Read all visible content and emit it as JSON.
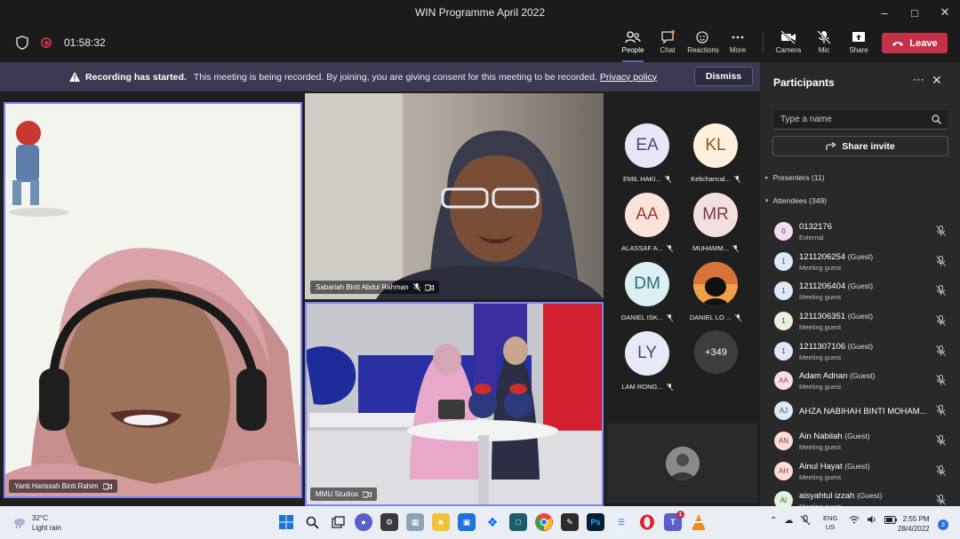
{
  "window": {
    "title": "WIN Programme April 2022"
  },
  "toolbar": {
    "timer": "01:58:32",
    "people": "People",
    "chat": "Chat",
    "reactions": "Reactions",
    "more": "More",
    "camera": "Camera",
    "mic": "Mic",
    "share": "Share",
    "leave": "Leave"
  },
  "banner": {
    "heading": "Recording has started.",
    "message": "This meeting is being recorded. By joining, you are giving consent for this meeting to be recorded.",
    "link": "Privacy policy",
    "dismiss": "Dismiss"
  },
  "stage": {
    "tiles": [
      {
        "name": "Yanti Harissah Binti Rahim"
      },
      {
        "name": "Sabariah Binti Abdul Rahman"
      },
      {
        "name": "MMU Studios"
      }
    ],
    "roster": [
      {
        "initials": "EA",
        "name": "EMIL HAKI...",
        "bg": "#e8e6f6"
      },
      {
        "initials": "KL",
        "name": "Kelichancal...",
        "bg": "#fdf0dc"
      },
      {
        "initials": "AA",
        "name": "ALASSAF A...",
        "bg": "#fbe3dc"
      },
      {
        "initials": "MR",
        "name": "MUHAMM...",
        "bg": "#f2dfe0"
      },
      {
        "initials": "DM",
        "name": "DANIEL ISK...",
        "bg": "#dcf0f3"
      },
      {
        "initials": "",
        "name": "DANIEL LO ...",
        "bg": "#c0703a"
      },
      {
        "initials": "LY",
        "name": "LAM RONG...",
        "bg": "#e8e9f6"
      }
    ],
    "more_count": "+349"
  },
  "panel": {
    "title": "Participants",
    "search_placeholder": "Type a name",
    "share_invite": "Share invite",
    "presenters": "Presenters (11)",
    "attendees": "Attendees (349)",
    "people": [
      {
        "initials": "0",
        "name": "0132176",
        "guest": "",
        "sub": "External",
        "bg": "#f2dcef"
      },
      {
        "initials": "1",
        "name": "1211206254",
        "guest": "(Guest)",
        "sub": "Meeting guest",
        "bg": "#dde9f8"
      },
      {
        "initials": "1",
        "name": "1211206404",
        "guest": "(Guest)",
        "sub": "Meeting guest",
        "bg": "#dde9f8"
      },
      {
        "initials": "1",
        "name": "1211306351",
        "guest": "(Guest)",
        "sub": "Meeting guest",
        "bg": "#e5f3dc"
      },
      {
        "initials": "1",
        "name": "1211307106",
        "guest": "(Guest)",
        "sub": "Meeting guest",
        "bg": "#dde9f8"
      },
      {
        "initials": "AA",
        "name": "Adam Adnan",
        "guest": "(Guest)",
        "sub": "Meeting guest",
        "bg": "#f6dfe6"
      },
      {
        "initials": "AJ",
        "name": "AHZA NABIHAH BINTI MOHAM...",
        "guest": "",
        "sub": "",
        "bg": "#dfe9f6"
      },
      {
        "initials": "AN",
        "name": "Ain Nabilah",
        "guest": "(Guest)",
        "sub": "Meeting guest",
        "bg": "#f8dcd6"
      },
      {
        "initials": "AH",
        "name": "Ainul Hayat",
        "guest": "(Guest)",
        "sub": "Meeting guest",
        "bg": "#f8dcd6"
      },
      {
        "initials": "AI",
        "name": "aisyahtul izzah",
        "guest": "(Guest)",
        "sub": "Meeting guest",
        "bg": "#e2f2dc"
      }
    ]
  },
  "taskbar": {
    "temp": "32°C",
    "weather": "Light rain",
    "lang1": "ENG",
    "lang2": "US",
    "time": "2:55 PM",
    "date": "28/4/2022",
    "notifications": "3",
    "teams_badge": "1"
  }
}
